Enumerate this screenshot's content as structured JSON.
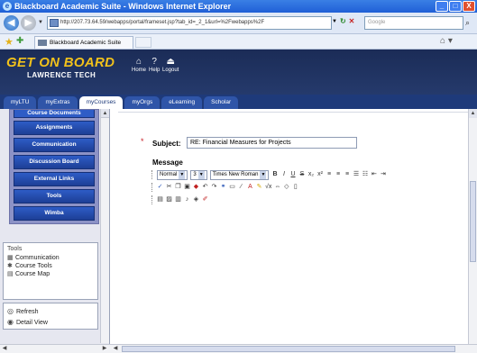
{
  "window": {
    "title": "Blackboard Academic Suite - Windows Internet Explorer",
    "minimize": "_",
    "maximize": "□",
    "close": "X"
  },
  "browser": {
    "url": "http://207.73.64.59/webapps/portal/frameset.jsp?tab_id=_2_1&url=%2Fwebapps%2F",
    "search_placeholder": "Google",
    "tab_title": "Blackboard Academic Suite"
  },
  "banner": {
    "logo_main": "GET ON BOARD",
    "logo_sub": "LAWRENCE TECH",
    "home": "Home",
    "help": "Help",
    "logout": "Logout"
  },
  "nav_tabs": [
    "myLTU",
    "myExtras",
    "myCourses",
    "myOrgs",
    "eLearning",
    "Scholar"
  ],
  "active_tab": "myCourses",
  "course_menu": {
    "partial_top": "Course Documents",
    "items": [
      "Assignments",
      "Communication",
      "Discussion Board",
      "External Links",
      "Tools",
      "Wimba"
    ]
  },
  "tools_panel": {
    "title": "Tools",
    "items": [
      "Communication",
      "Course Tools",
      "Course Map"
    ],
    "actions": [
      "Refresh",
      "Detail View"
    ]
  },
  "form": {
    "subject_label": "Subject:",
    "subject_value": "RE: Financial Measures for Projects",
    "message_label": "Message",
    "format_select": "Normal",
    "size_select": "3",
    "font_select": "Times New Roman"
  },
  "colors": {
    "banner": "#1b2c57",
    "logo": "#f2c21b",
    "menu_button": "#2e5cc6",
    "titlebar": "#1f5fd6"
  }
}
